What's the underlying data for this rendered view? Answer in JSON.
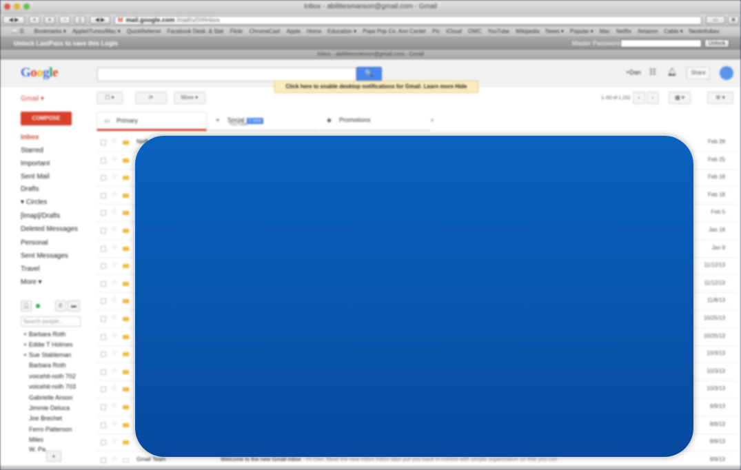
{
  "window": {
    "title": "Inbox - abilitiesmanson@gmail.com - Gmail"
  },
  "browser": {
    "url_domain": "mail.google.com",
    "url_rest": "/mail/u/0/#inbox",
    "back_label": "◀ ▶",
    "bookmarks": [
      "Bookmarks ▾",
      "Apple/iTunes/Mac ▾",
      "QuickReferrer",
      "Facebook Desk. & Stat",
      "Flickr",
      "ChromeCast",
      "Apple",
      "Home",
      "Education ▾",
      "Pope Pop Co. Ann Center",
      "Pic",
      "iCloud",
      "OWC",
      "YouTube",
      "Wikipedia",
      "News ▾",
      "Popular ▾",
      "Mac",
      "Netflix",
      "Amazon",
      "Cable ▾",
      "Nextinfo&eu"
    ],
    "lastpass": {
      "message": "Unlock LastPass to save this Login",
      "master_password_label": "Master Password:",
      "unlock_button": "Unlock"
    },
    "tab_title": "Inbox - abilitiesmanson@gmail.com - Gmail"
  },
  "header": {
    "logo_letters": [
      "G",
      "o",
      "o",
      "g",
      "l",
      "e"
    ],
    "search_button_icon": "search-icon",
    "search_button_glyph": "🔍",
    "plus_user": "+Dan",
    "share_label": "Share",
    "notification": "Click here to enable desktop notifications for Gmail.   Learn more   Hide"
  },
  "toolbar": {
    "gmail_label": "Gmail ▾",
    "select_label": "☐ ▾",
    "refresh_glyph": "⟳",
    "more_label": "More ▾",
    "page_info": "1–50 of 1,152",
    "prev_glyph": "‹",
    "next_glyph": "›",
    "input_tools": "▦ ▾",
    "settings_glyph": "⚙ ▾"
  },
  "sidebar": {
    "compose_label": "COMPOSE",
    "items": [
      {
        "label": "Inbox",
        "active": true
      },
      {
        "label": "Starred"
      },
      {
        "label": "Important"
      },
      {
        "label": "Sent Mail"
      },
      {
        "label": "Drafts"
      },
      {
        "label": "▾ Circles"
      },
      {
        "label": "[Imap]/Drafts"
      },
      {
        "label": "Deleted Messages"
      },
      {
        "label": "Personal"
      },
      {
        "label": "Sent Messages"
      },
      {
        "label": "Travel"
      },
      {
        "label": "More ▾"
      }
    ],
    "chat": {
      "search_placeholder": "Search people...",
      "contacts": [
        "+ Barbara Roth",
        "+ Eddie T Holmes",
        "+ Sue Stableman",
        "Barbara Roth",
        "voicehit-nolh 702",
        "voicehit-nolh 703",
        "Gabrielle Anson",
        "Jimmie Deluca",
        "Joe Brechet",
        "Ferro Patterson",
        "Miles",
        "W. Pa..."
      ]
    }
  },
  "inbox_tabs": [
    {
      "label": "Primary",
      "icon": "inbox-icon"
    },
    {
      "label": "Social",
      "badge": "1 new",
      "sub": "YouTube",
      "icon": "people-icon"
    },
    {
      "label": "Promotions",
      "icon": "tag-icon"
    }
  ],
  "rows": [
    {
      "sender": "Netfl",
      "date": "Feb 28"
    },
    {
      "sender": "",
      "date": "Feb 25"
    },
    {
      "sender": "",
      "date": "Feb 18"
    },
    {
      "sender": "",
      "date": "Feb 18"
    },
    {
      "sender": "",
      "date": "Feb 5"
    },
    {
      "sender": "",
      "date": "Jan 18"
    },
    {
      "sender": "",
      "date": "Jan 9"
    },
    {
      "sender": "",
      "date": "11/12/13"
    },
    {
      "sender": "",
      "date": "11/12/13"
    },
    {
      "sender": "",
      "date": "11/8/13"
    },
    {
      "sender": "",
      "date": "10/25/13"
    },
    {
      "sender": "",
      "date": "10/25/13"
    },
    {
      "sender": "",
      "date": "10/3/13"
    },
    {
      "sender": "",
      "date": "10/3/13"
    },
    {
      "sender": "",
      "date": "10/3/13"
    },
    {
      "sender": "",
      "date": "9/9/13"
    },
    {
      "sender": "",
      "date": "8/9/13"
    },
    {
      "sender": "",
      "date": "8/9/13"
    },
    {
      "sender": "Gmail Team",
      "subject": "Welcome to the new Gmail inbox",
      "snippet": "- Hi Dan, Meet the new inbox Inbox tabs put you back in control with simple organization so that you can",
      "date": "8/9/13"
    }
  ],
  "overlay": {
    "color_top": "#0a62bf",
    "color_bottom": "#064a9e"
  }
}
